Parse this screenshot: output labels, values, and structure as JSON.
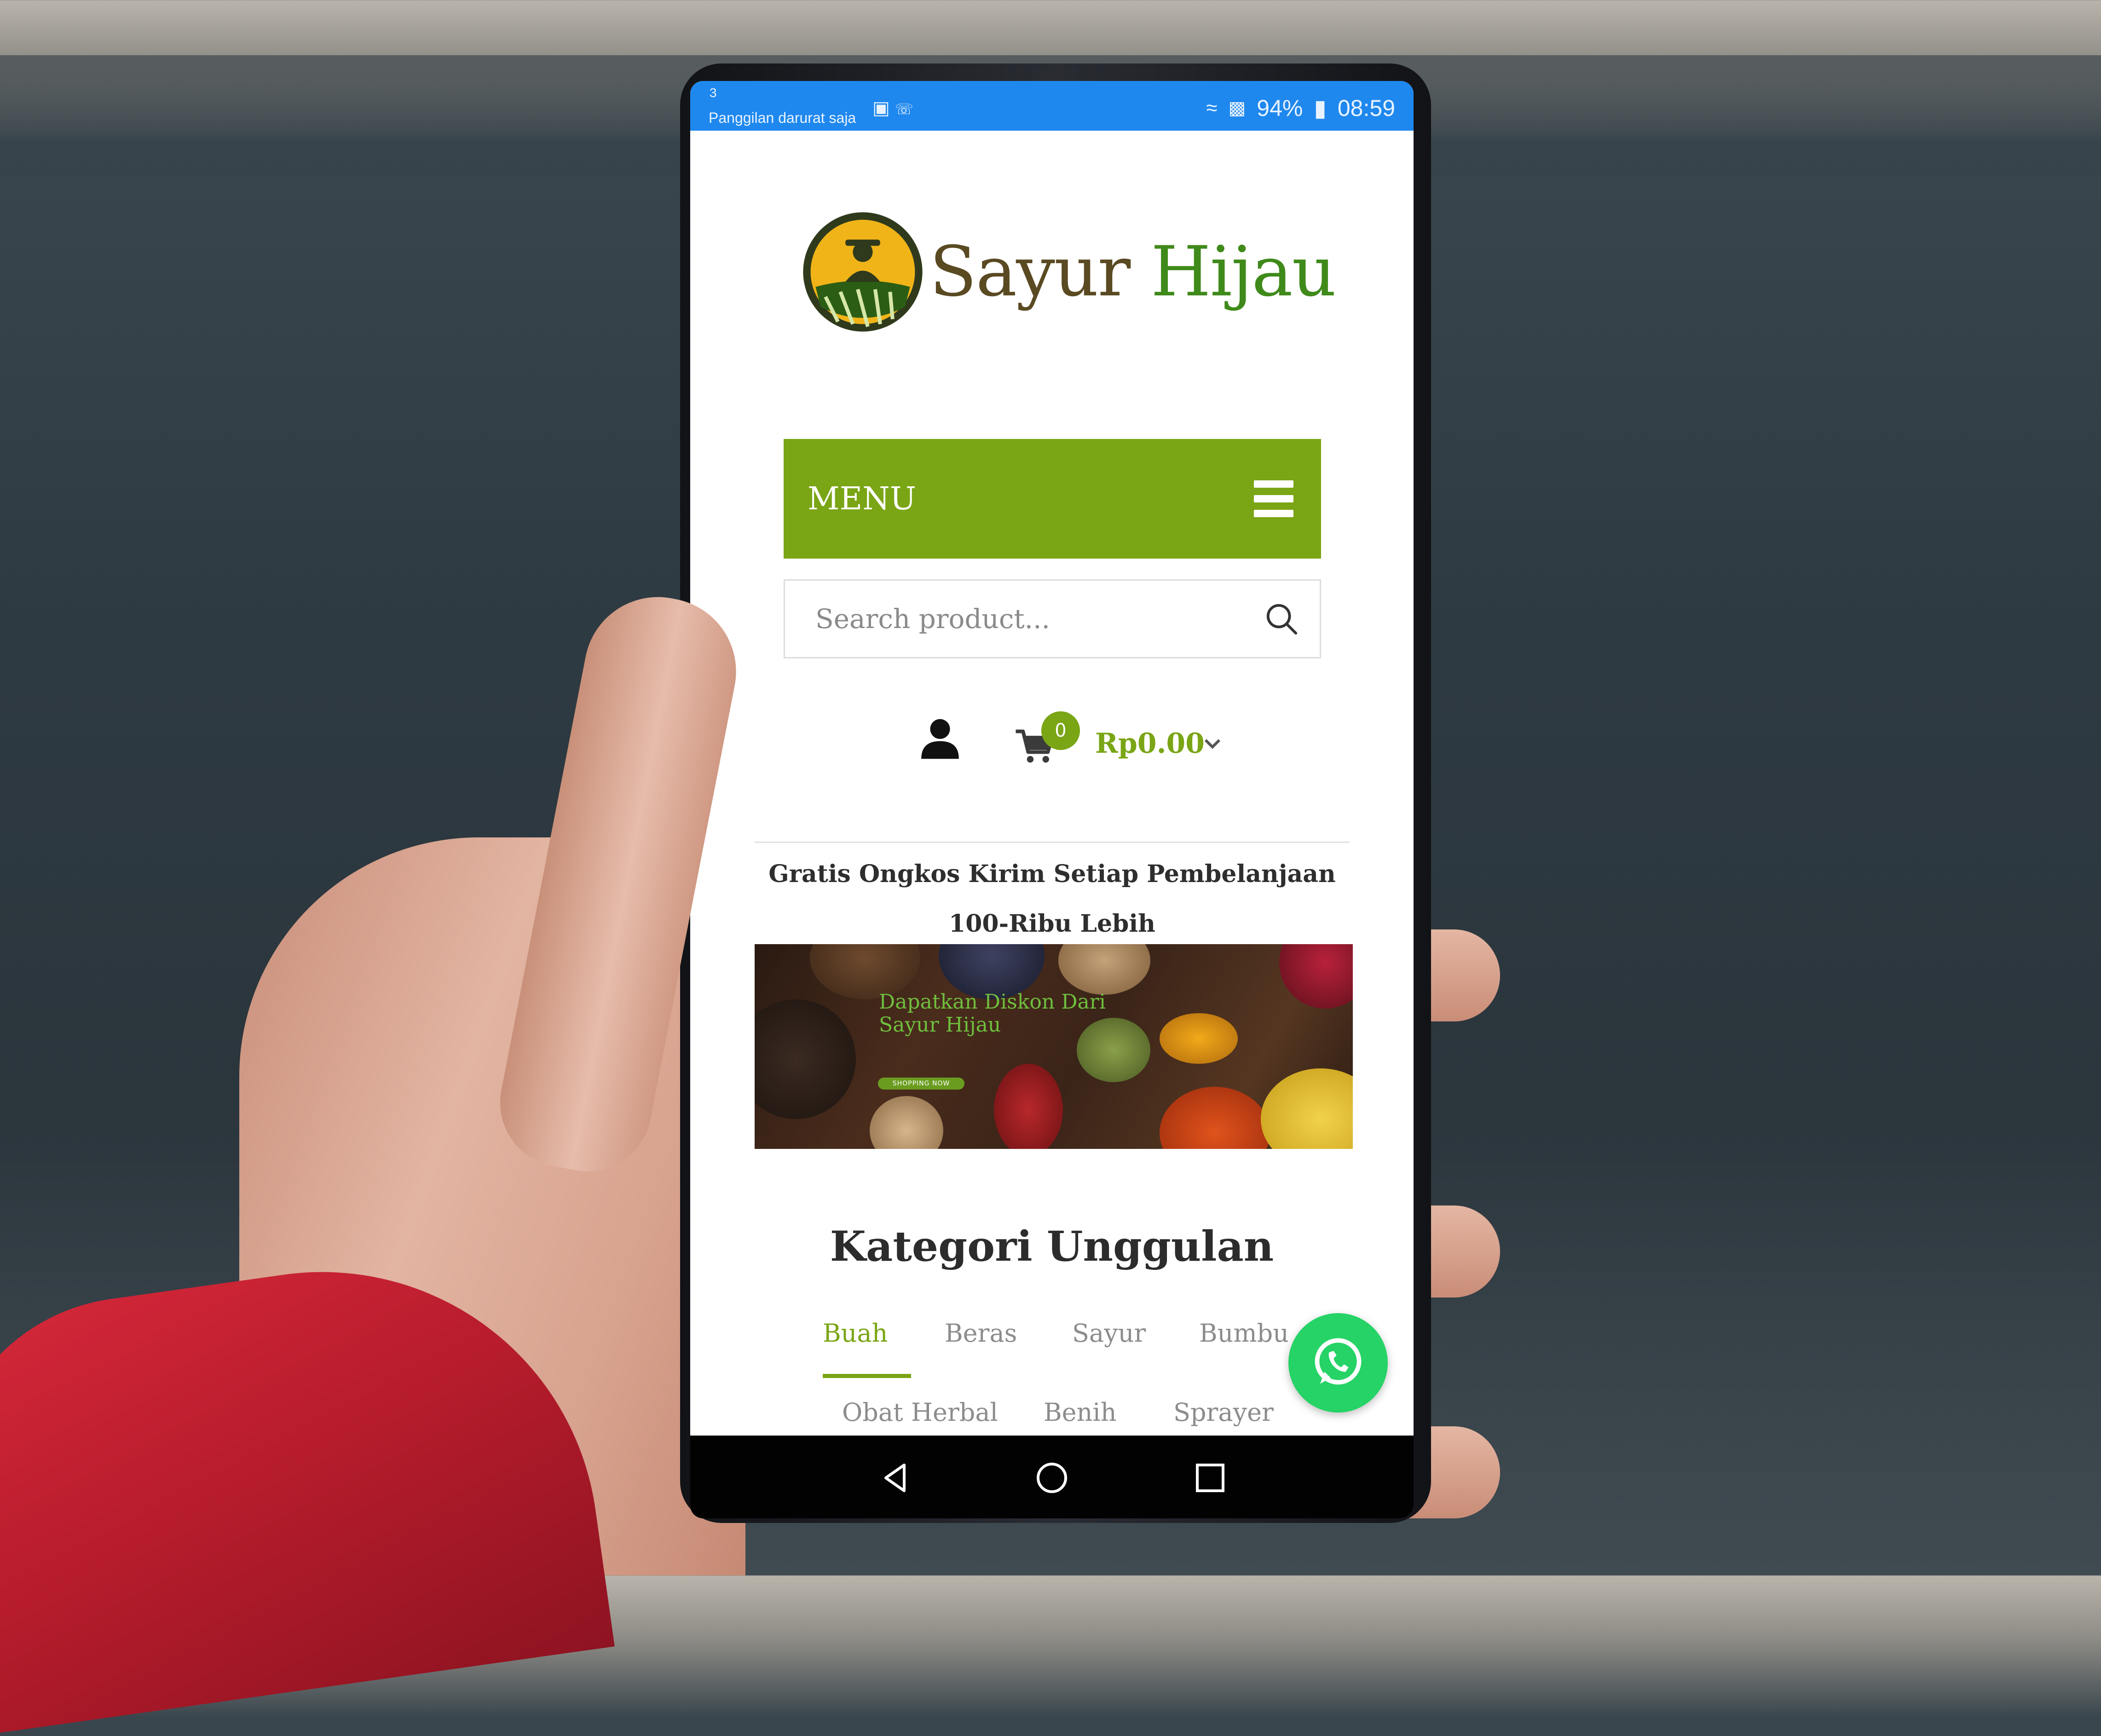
{
  "status_bar": {
    "sim_indicator": "3",
    "carrier_text": "Panggilan darurat saja",
    "battery_percent": "94%",
    "time": "08:59"
  },
  "logo": {
    "word_1": "Sayur",
    "word_2": "Hijau"
  },
  "menu": {
    "label": "MENU"
  },
  "search": {
    "placeholder": "Search product..."
  },
  "cart": {
    "count": "0",
    "total": "Rp0.00"
  },
  "promo": {
    "text": "Gratis Ongkos Kirim Setiap Pembelanjaan 100-Ribu Lebih"
  },
  "banner": {
    "line_1": "Dapatkan Diskon Dari",
    "line_2": "Sayur Hijau",
    "button": "SHOPPING NOW"
  },
  "categories": {
    "title": "Kategori Unggulan",
    "tabs": [
      "Buah",
      "Beras",
      "Sayur",
      "Bumbu",
      "Obat Herbal",
      "Benih",
      "Sprayer"
    ],
    "active_tab": "Buah"
  },
  "colors": {
    "brand_green": "#7aa515",
    "status_bar_blue": "#1f88ee",
    "whatsapp_green": "#25d366"
  },
  "icons": [
    "hamburger-icon",
    "search-icon",
    "user-icon",
    "cart-icon",
    "chevron-down-icon",
    "whatsapp-icon",
    "back-icon",
    "home-icon",
    "recents-icon"
  ]
}
